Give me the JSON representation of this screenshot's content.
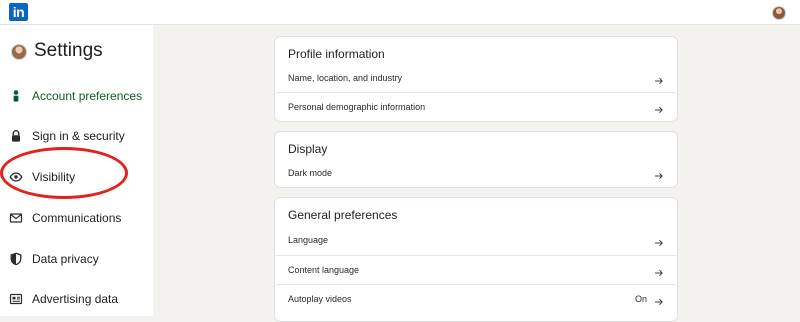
{
  "topbar": {
    "logo_text": "in"
  },
  "sidebar": {
    "title": "Settings",
    "items": [
      {
        "label": "Account preferences",
        "icon": "person-icon",
        "active": true
      },
      {
        "label": "Sign in & security",
        "icon": "lock-icon"
      },
      {
        "label": "Visibility",
        "icon": "eye-icon"
      },
      {
        "label": "Communications",
        "icon": "envelope-icon"
      },
      {
        "label": "Data privacy",
        "icon": "shield-icon"
      },
      {
        "label": "Advertising data",
        "icon": "newspaper-icon"
      }
    ]
  },
  "main": {
    "sections": [
      {
        "title": "Profile information",
        "rows": [
          {
            "label": "Name, location, and industry"
          },
          {
            "label": "Personal demographic information"
          }
        ]
      },
      {
        "title": "Display",
        "rows": [
          {
            "label": "Dark mode"
          }
        ]
      },
      {
        "title": "General preferences",
        "rows": [
          {
            "label": "Language"
          },
          {
            "label": "Content language"
          },
          {
            "label": "Autoplay videos",
            "value": "On"
          }
        ]
      }
    ]
  },
  "colors": {
    "brand": "#0a66c2",
    "active_nav": "#0a5d2a",
    "annotation": "#e2231a",
    "background": "#f4f2ee"
  }
}
